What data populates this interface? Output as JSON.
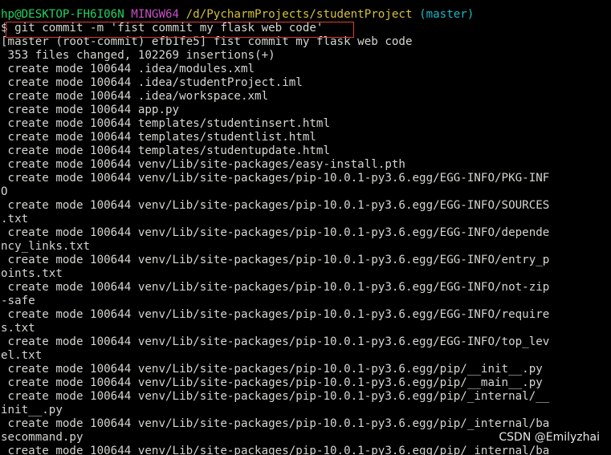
{
  "prompt": {
    "user_host": "hp@DESKTOP-FH6I06N",
    "app": "MINGW64",
    "path": "/d/PycharmProjects/studentProject",
    "branch": "(master)"
  },
  "command": {
    "symbol": "$",
    "text": " git commit -m 'fist commit my flask web code'"
  },
  "output": [
    "[master (root-commit) efb1fe5] fist commit my flask web code",
    " 353 files changed, 102269 insertions(+)",
    " create mode 100644 .idea/modules.xml",
    " create mode 100644 .idea/studentProject.iml",
    " create mode 100644 .idea/workspace.xml",
    " create mode 100644 app.py",
    " create mode 100644 templates/studentinsert.html",
    " create mode 100644 templates/studentlist.html",
    " create mode 100644 templates/studentupdate.html",
    " create mode 100644 venv/Lib/site-packages/easy-install.pth",
    " create mode 100644 venv/Lib/site-packages/pip-10.0.1-py3.6.egg/EGG-INFO/PKG-INF",
    "O",
    " create mode 100644 venv/Lib/site-packages/pip-10.0.1-py3.6.egg/EGG-INFO/SOURCES",
    ".txt",
    " create mode 100644 venv/Lib/site-packages/pip-10.0.1-py3.6.egg/EGG-INFO/depende",
    "ncy_links.txt",
    " create mode 100644 venv/Lib/site-packages/pip-10.0.1-py3.6.egg/EGG-INFO/entry_p",
    "oints.txt",
    " create mode 100644 venv/Lib/site-packages/pip-10.0.1-py3.6.egg/EGG-INFO/not-zip",
    "-safe",
    " create mode 100644 venv/Lib/site-packages/pip-10.0.1-py3.6.egg/EGG-INFO/require",
    "s.txt",
    " create mode 100644 venv/Lib/site-packages/pip-10.0.1-py3.6.egg/EGG-INFO/top_lev",
    "el.txt",
    " create mode 100644 venv/Lib/site-packages/pip-10.0.1-py3.6.egg/pip/__init__.py",
    " create mode 100644 venv/Lib/site-packages/pip-10.0.1-py3.6.egg/pip/__main__.py",
    " create mode 100644 venv/Lib/site-packages/pip-10.0.1-py3.6.egg/pip/_internal/__",
    "init__.py",
    " create mode 100644 venv/Lib/site-packages/pip-10.0.1-py3.6.egg/pip/_internal/ba",
    "secommand.py",
    " create mode 100644 venv/Lib/site-packages/pip-10.0.1-py3.6.egg/pip/_internal/ba"
  ],
  "watermark": "CSDN @Emilyzhai",
  "colors": {
    "background": "#000000",
    "text": "#d3d7cf",
    "prompt_user": "#23d160",
    "prompt_app": "#c94fc9",
    "prompt_path": "#d6c03a",
    "prompt_branch": "#1bb6c6",
    "highlight_box": "#e03a3a"
  }
}
